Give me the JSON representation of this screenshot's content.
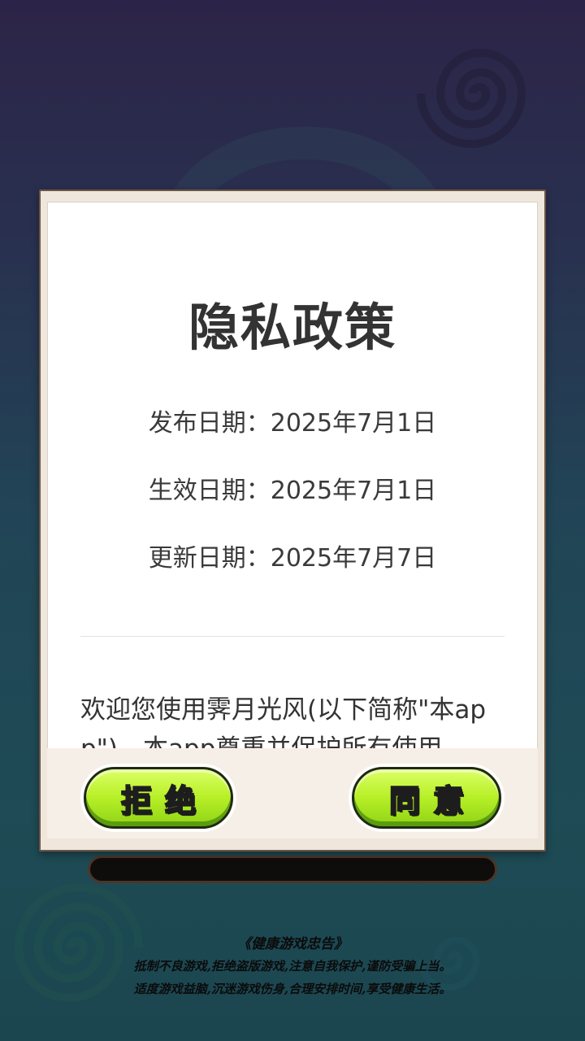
{
  "dialog": {
    "title": "隐私政策",
    "dates": [
      {
        "label": "发布日期：",
        "value": "2025年7月1日"
      },
      {
        "label": "生效日期：",
        "value": "2025年7月1日"
      },
      {
        "label": "更新日期：",
        "value": "2025年7月7日"
      }
    ],
    "intro_text": "欢迎您使用霁月光风(以下简称\"本app\")。本app尊重并保护所有使用",
    "reject_label": "拒绝",
    "agree_label": "同意"
  },
  "health_notice": {
    "title": "《健康游戏忠告》",
    "lines": [
      "抵制不良游戏,拒绝盗版游戏,注意自我保护,谨防受骗上当。",
      "适度游戏益脑,沉迷游戏伤身,合理安排时间,享受健康生活。"
    ]
  },
  "colors": {
    "button_green": "#b8f028",
    "title_text": "#333333",
    "modal_frame": "#6b5546"
  }
}
